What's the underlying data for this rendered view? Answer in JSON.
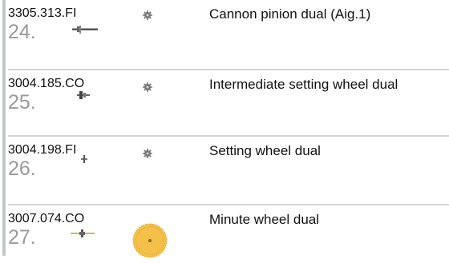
{
  "parts": [
    {
      "code": "3305.313.FI",
      "number": "24.",
      "description": "Cannon pinion dual (Aig.1)",
      "part_icon": "cannon-pinion-icon",
      "gear_icon": "small-gear-icon"
    },
    {
      "code": "3004.185.CO",
      "number": "25.",
      "description": "Intermediate setting wheel dual",
      "part_icon": "intermediate-wheel-side-icon",
      "gear_icon": "small-gear-icon"
    },
    {
      "code": "3004.198.FI",
      "number": "26.",
      "description": "Setting wheel dual",
      "part_icon": "setting-wheel-side-icon",
      "gear_icon": "small-gear-icon"
    },
    {
      "code": "3007.074.CO",
      "number": "27.",
      "description": "Minute wheel dual",
      "part_icon": "minute-wheel-side-icon",
      "gear_icon": "large-gold-gear-icon"
    }
  ],
  "colors": {
    "text": "#111111",
    "number": "#9a9a9a",
    "divider": "#d4d4d4",
    "gold_gear": "#f5c04a"
  }
}
